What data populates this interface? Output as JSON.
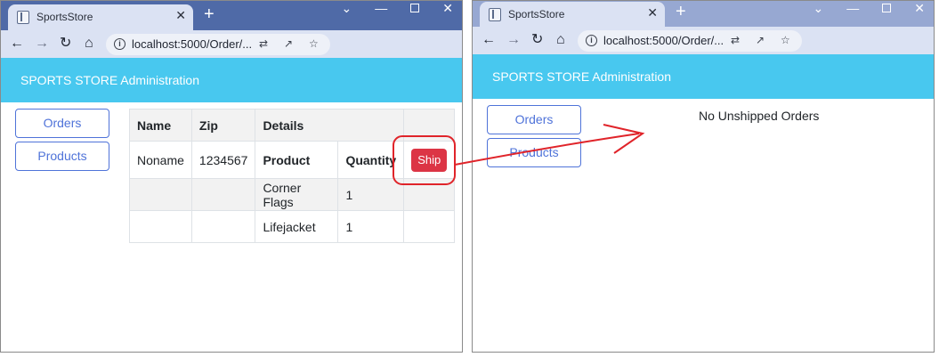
{
  "left_window": {
    "tab_title": "SportsStore",
    "address": "localhost:5000/Order/...",
    "app_title": "SPORTS STORE Administration",
    "sidebar": {
      "orders_label": "Orders",
      "products_label": "Products"
    },
    "table": {
      "headers": {
        "name": "Name",
        "zip": "Zip",
        "details": "Details"
      },
      "order": {
        "name": "Noname",
        "zip": "1234567",
        "product_header": "Product",
        "quantity_header": "Quantity",
        "ship_label": "Ship"
      },
      "lines": [
        {
          "product": "Corner Flags",
          "quantity": "1"
        },
        {
          "product": "Lifejacket",
          "quantity": "1"
        }
      ]
    }
  },
  "right_window": {
    "tab_title": "SportsStore",
    "address": "localhost:5000/Order/...",
    "app_title": "SPORTS STORE Administration",
    "sidebar": {
      "orders_label": "Orders",
      "products_label": "Products"
    },
    "message": "No Unshipped Orders"
  },
  "colors": {
    "tabbar_active": "#4f6aa7",
    "tabbar_inactive": "#97a8d2",
    "toolbar": "#dbe2f3",
    "app_header": "#48c8ef",
    "sidebar_button": "#4f73d9",
    "ship_button": "#dc3545",
    "annotation": "#e0242a"
  },
  "icons": {
    "back": "arrow-left-icon",
    "forward": "arrow-right-icon",
    "reload": "reload-icon",
    "home": "home-icon",
    "info": "info-icon",
    "translate": "translate-icon",
    "share": "share-icon",
    "bookmark": "star-icon"
  }
}
